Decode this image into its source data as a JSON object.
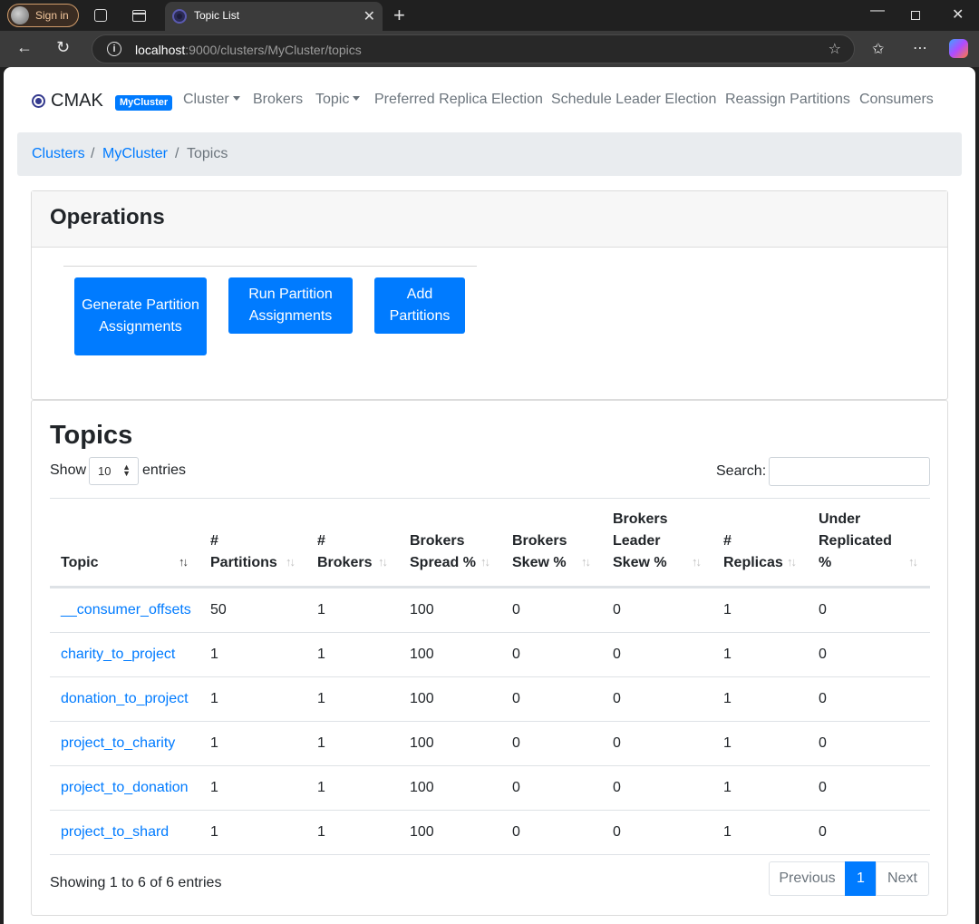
{
  "browser": {
    "signin_label": "Sign in",
    "tab_title": "Topic List",
    "url_host": "localhost",
    "url_rest": ":9000/clusters/MyCluster/topics"
  },
  "navbar": {
    "brand": "CMAK",
    "cluster_badge": "MyCluster",
    "links": [
      "Cluster",
      "Brokers",
      "Topic",
      "Preferred Replica Election",
      "Schedule Leader Election",
      "Reassign Partitions",
      "Consumers"
    ]
  },
  "breadcrumb": {
    "items": [
      "Clusters",
      "MyCluster",
      "Topics"
    ],
    "separator": "/"
  },
  "operations": {
    "title": "Operations",
    "buttons": [
      "Generate Partition Assignments",
      "Run Partition Assignments",
      "Add Partitions"
    ]
  },
  "topics": {
    "title": "Topics",
    "show_label": "Show",
    "page_size": "10",
    "entries_label": "entries",
    "search_label": "Search:",
    "columns": [
      "Topic",
      "# Partitions",
      "# Brokers",
      "Brokers Spread %",
      "Brokers Skew %",
      "Brokers Leader Skew %",
      "# Replicas",
      "Under Replicated %"
    ],
    "rows": [
      [
        "__consumer_offsets",
        "50",
        "1",
        "100",
        "0",
        "0",
        "1",
        "0"
      ],
      [
        "charity_to_project",
        "1",
        "1",
        "100",
        "0",
        "0",
        "1",
        "0"
      ],
      [
        "donation_to_project",
        "1",
        "1",
        "100",
        "0",
        "0",
        "1",
        "0"
      ],
      [
        "project_to_charity",
        "1",
        "1",
        "100",
        "0",
        "0",
        "1",
        "0"
      ],
      [
        "project_to_donation",
        "1",
        "1",
        "100",
        "0",
        "0",
        "1",
        "0"
      ],
      [
        "project_to_shard",
        "1",
        "1",
        "100",
        "0",
        "0",
        "1",
        "0"
      ]
    ],
    "info": "Showing 1 to 6 of 6 entries",
    "pagination": {
      "previous": "Previous",
      "current": "1",
      "next": "Next"
    }
  },
  "colors": {
    "primary": "#007bff",
    "muted": "#6c757d",
    "breadcrumb_bg": "#e9ecef"
  }
}
